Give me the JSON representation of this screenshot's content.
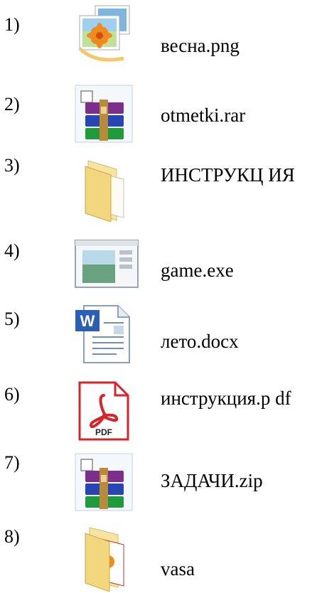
{
  "items": [
    {
      "num": "1)",
      "name": "весна.png",
      "icon": "image-file-icon"
    },
    {
      "num": "2)",
      "name": "otmetki.rar",
      "icon": "rar-archive-icon"
    },
    {
      "num": "3)",
      "name": "ИНСТРУКЦ ИЯ",
      "icon": "folder-icon"
    },
    {
      "num": "4)",
      "name": "game.exe",
      "icon": "executable-window-icon"
    },
    {
      "num": "5)",
      "name": "лето.docx",
      "icon": "word-document-icon"
    },
    {
      "num": "6)",
      "name": "инструкция.p df",
      "icon": "pdf-document-icon"
    },
    {
      "num": "7)",
      "name": "ЗАДАЧИ.zip",
      "icon": "zip-archive-icon"
    },
    {
      "num": "8)",
      "name": "vasa",
      "icon": "picture-folder-icon"
    }
  ],
  "colors": {
    "folder": "#f3d77e",
    "rar_purple": "#7b2f8a",
    "rar_blue": "#2746b3",
    "rar_green": "#1f9a3c",
    "word_blue": "#2b5fb3",
    "pdf_red": "#d8232a"
  }
}
